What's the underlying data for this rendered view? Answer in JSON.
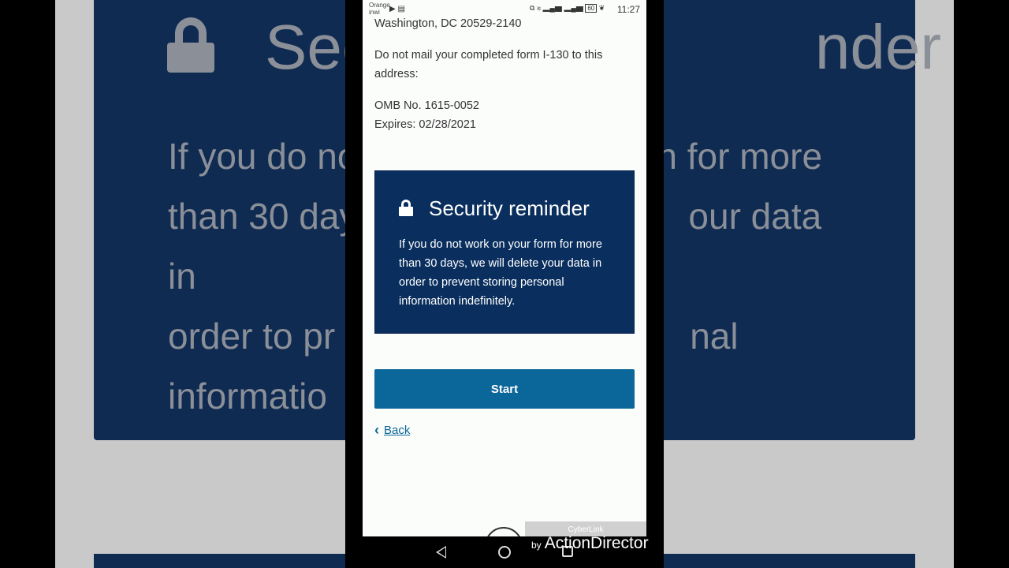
{
  "status_bar": {
    "carrier_line1": "Orange",
    "carrier_line2": "inwi",
    "left_icons": [
      "video-icon",
      "calendar-icon"
    ],
    "right_icons": [
      "cast-icon",
      "wifi-icon",
      "signal-icon",
      "signal-icon",
      "battery-icon",
      "leaf-icon"
    ],
    "battery": "60",
    "time": "11:27"
  },
  "page": {
    "address_line": "Washington, DC 20529-2140",
    "do_not_mail": "Do not mail your completed form I-130 to this address:",
    "omb": "OMB No. 1615-0052",
    "expires": "Expires: 02/28/2021"
  },
  "security_card": {
    "title": "Security reminder",
    "text": "If you do not work on your form for more than 30 days, we will delete your data in order to prevent storing personal information indefinitely."
  },
  "actions": {
    "start_label": "Start",
    "back_label": "Back"
  },
  "background": {
    "title_fragment_1": "Sec",
    "title_fragment_2": "nder",
    "text_line1": "If you do no",
    "text_line1b": "n for more",
    "text_line2": "than 30 day",
    "text_line2b": "our data in",
    "text_line3": "order to pr",
    "text_line3b": "nal",
    "text_line4": "informatio"
  },
  "watermark": {
    "box_label": "CyberLink",
    "by": "by",
    "name": "ActionDirector"
  },
  "colors": {
    "card_bg": "#0a2f5e",
    "button_bg": "#0b669a",
    "link": "#0b669a",
    "page_bg": "#fbfdfb"
  }
}
